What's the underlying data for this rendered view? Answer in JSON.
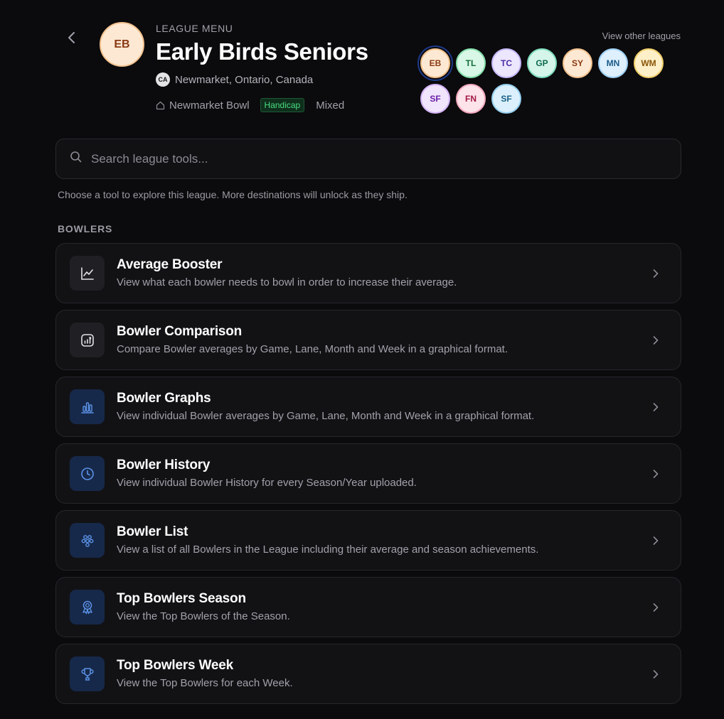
{
  "header": {
    "back_icon": "chevron-left-icon",
    "avatar_initials": "EB",
    "eyebrow": "LEAGUE MENU",
    "title": "Early Birds Seniors",
    "country_code": "CA",
    "location": "Newmarket, Ontario, Canada",
    "venue": "Newmarket Bowl",
    "handicap_badge": "Handicap",
    "gender": "Mixed"
  },
  "other_leagues": {
    "link_label": "View other leagues",
    "chips": [
      {
        "initials": "EB",
        "bg": "#fde9d3",
        "border": "#f3c28f",
        "color": "#8a3a14",
        "active": true
      },
      {
        "initials": "TL",
        "bg": "#d9f7e6",
        "border": "#86e0ad",
        "color": "#146c3c"
      },
      {
        "initials": "TC",
        "bg": "#ece6fe",
        "border": "#c7b8fb",
        "color": "#4c2ba8"
      },
      {
        "initials": "GP",
        "bg": "#d5f5ea",
        "border": "#7fdcbd",
        "color": "#0f6b50"
      },
      {
        "initials": "SY",
        "bg": "#fde9d3",
        "border": "#f3c28f",
        "color": "#8a3a14"
      },
      {
        "initials": "MN",
        "bg": "#def0fd",
        "border": "#9ed0f5",
        "color": "#1c5a88"
      },
      {
        "initials": "WM",
        "bg": "#fdf0c8",
        "border": "#f0cf6b",
        "color": "#8a5508"
      },
      {
        "initials": "SF",
        "bg": "#f1e4fd",
        "border": "#d3b2f7",
        "color": "#6a1fa8"
      },
      {
        "initials": "FN",
        "bg": "#fde3ea",
        "border": "#f5a9bf",
        "color": "#a31a45"
      },
      {
        "initials": "SF",
        "bg": "#dbf0fc",
        "border": "#96cff0",
        "color": "#185f86"
      }
    ]
  },
  "search": {
    "placeholder": "Search league tools...",
    "helper": "Choose a tool to explore this league. More destinations will unlock as they ship."
  },
  "section": {
    "label": "BOWLERS"
  },
  "tools": [
    {
      "title": "Average Booster",
      "desc": "View what each bowler needs to bowl in order to increase their average.",
      "icon": "line-chart-icon",
      "style": "neutral"
    },
    {
      "title": "Bowler Comparison",
      "desc": "Compare Bowler averages by Game, Lane, Month and Week in a graphical format.",
      "icon": "chart-box-icon",
      "style": "neutral"
    },
    {
      "title": "Bowler Graphs",
      "desc": "View individual Bowler averages by Game, Lane, Month and Week in a graphical format.",
      "icon": "bar-chart-icon",
      "style": "blue"
    },
    {
      "title": "Bowler History",
      "desc": "View individual Bowler History for every Season/Year uploaded.",
      "icon": "clock-icon",
      "style": "blue"
    },
    {
      "title": "Bowler List",
      "desc": "View a list of all Bowlers in the League including their average and season achievements.",
      "icon": "users-icon",
      "style": "blue"
    },
    {
      "title": "Top Bowlers Season",
      "desc": "View the Top Bowlers of the Season.",
      "icon": "award-icon",
      "style": "blue"
    },
    {
      "title": "Top Bowlers Week",
      "desc": "View the Top Bowlers for each Week.",
      "icon": "trophy-icon",
      "style": "blue"
    }
  ]
}
